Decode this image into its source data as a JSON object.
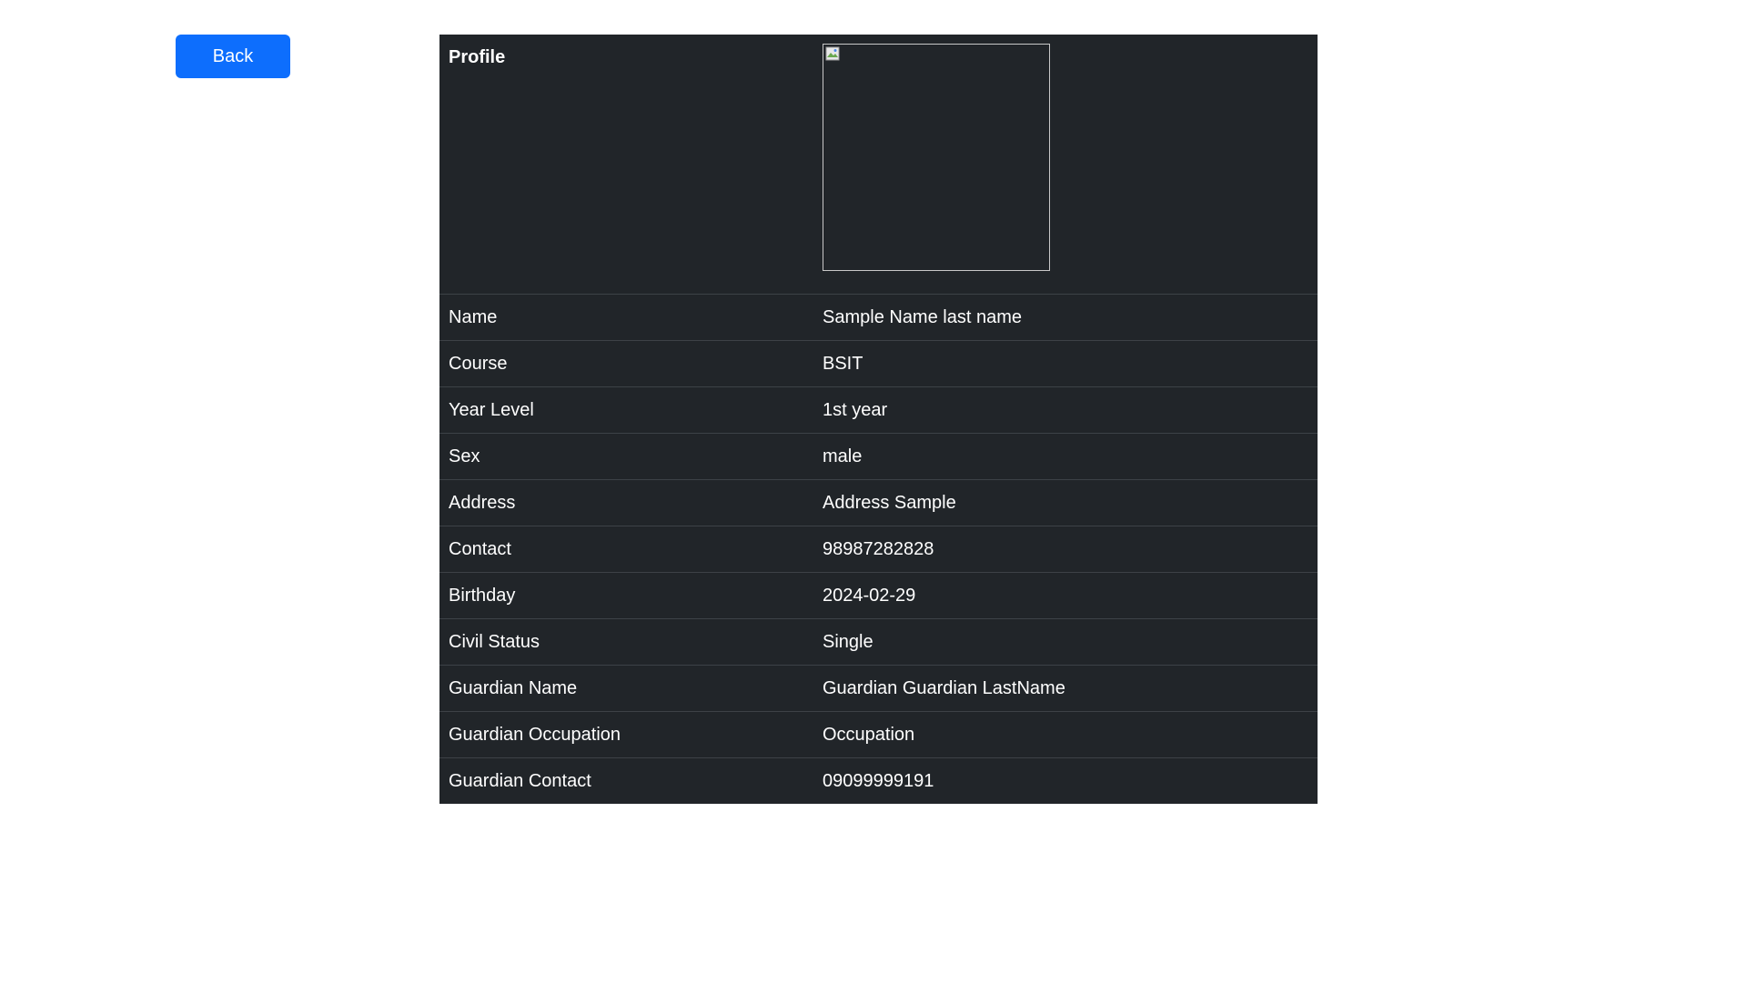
{
  "toolbar": {
    "back_label": "Back"
  },
  "profile": {
    "title": "Profile",
    "photo_alt": "",
    "fields": [
      {
        "label": "Name",
        "value": "Sample Name last name"
      },
      {
        "label": "Course",
        "value": "BSIT"
      },
      {
        "label": "Year Level",
        "value": "1st year"
      },
      {
        "label": "Sex",
        "value": "male"
      },
      {
        "label": "Address",
        "value": "Address Sample"
      },
      {
        "label": "Contact",
        "value": "98987282828"
      },
      {
        "label": "Birthday",
        "value": "2024-02-29"
      },
      {
        "label": "Civil Status",
        "value": "Single"
      },
      {
        "label": "Guardian Name",
        "value": "Guardian Guardian LastName"
      },
      {
        "label": "Guardian Occupation",
        "value": "Occupation"
      },
      {
        "label": "Guardian Contact",
        "value": "09099999191"
      }
    ]
  },
  "colors": {
    "primary_button": "#0d6efd",
    "table_background": "#212529",
    "table_text": "#ffffff"
  }
}
